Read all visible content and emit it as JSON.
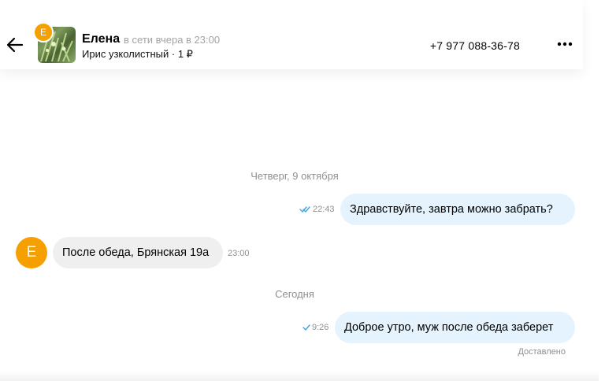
{
  "header": {
    "contact_name": "Елена",
    "status": "в сети вчера в 23:00",
    "ad_title": "Ирис узколистный · 1 ₽",
    "phone": "+7 977 088-36-78",
    "avatar_letter": "Е",
    "icons": [
      "arrow-left-icon",
      "more-dots-icon"
    ]
  },
  "messages": [
    {
      "type": "date",
      "text": "Четверг, 9 октября"
    },
    {
      "type": "outgoing",
      "text": "Здравствуйте, завтра можно забрать?",
      "time": "22:43",
      "status_icon": "double-check-icon"
    },
    {
      "type": "incoming",
      "text": "После обеда, Брянская 19а",
      "time": "23:00",
      "avatar_letter": "Е"
    },
    {
      "type": "date",
      "text": "Сегодня"
    },
    {
      "type": "outgoing",
      "text": "Доброе утро, муж после обеда заберет",
      "time": "9:26",
      "status_icon": "single-check-icon",
      "delivery_status": "Доставлено"
    }
  ],
  "colors": {
    "accent_orange": "#f5a000",
    "outgoing_bubble": "#e4f3fd",
    "incoming_bubble": "#efefef",
    "check_blue": "#3da5e6"
  }
}
